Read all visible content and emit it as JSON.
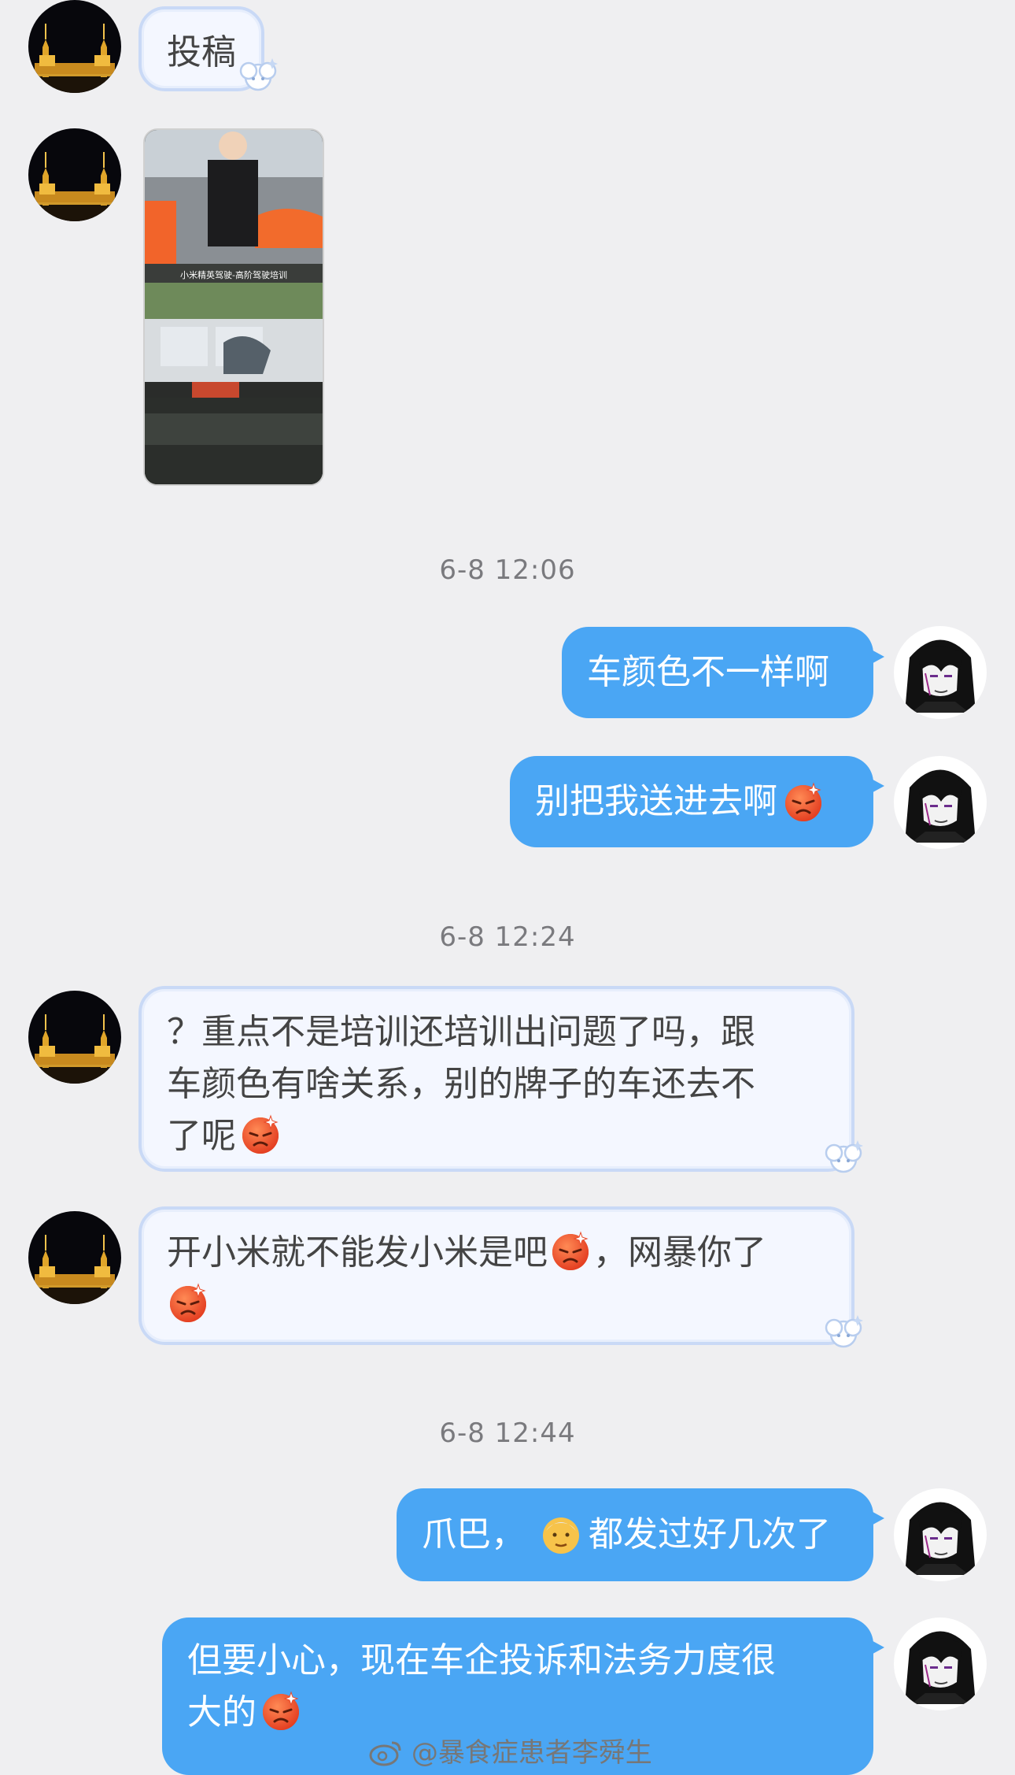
{
  "messages": {
    "m1": "投稿",
    "m3": "车颜色不一样啊",
    "m4": "别把我送进去啊",
    "m5_line1": "？重点不是培训还培训出问题了吗，跟",
    "m5_line2": "车颜色有啥关系，别的牌子的车还去不",
    "m5_line3": "了呢",
    "m6_line1a": "开小米就不能发小米是吧",
    "m6_line1b": "，网暴你了",
    "m7a": "爪巴，",
    "m7b": "都发过好几次了",
    "m8_line1": "但要小心，现在车企投诉和法务力度很",
    "m8_line2": "大的"
  },
  "timestamps": {
    "t1": "6-8 12:06",
    "t2": "6-8 12:24",
    "t3": "6-8 12:44"
  },
  "video": {
    "caption": "小米精英驾驶-高阶驾驶培训"
  },
  "watermark": "@暴食症患者李舜生",
  "colors": {
    "background": "#efeff1",
    "right_bubble": "#4aa6f4",
    "left_bubble_bg": "#f4f7ff",
    "left_bubble_border": "#c9d9f6"
  },
  "icons": {
    "angry_emoji": "angry-face-icon",
    "old_man_emoji": "old-man-face-icon",
    "weibo_logo": "weibo-icon"
  }
}
